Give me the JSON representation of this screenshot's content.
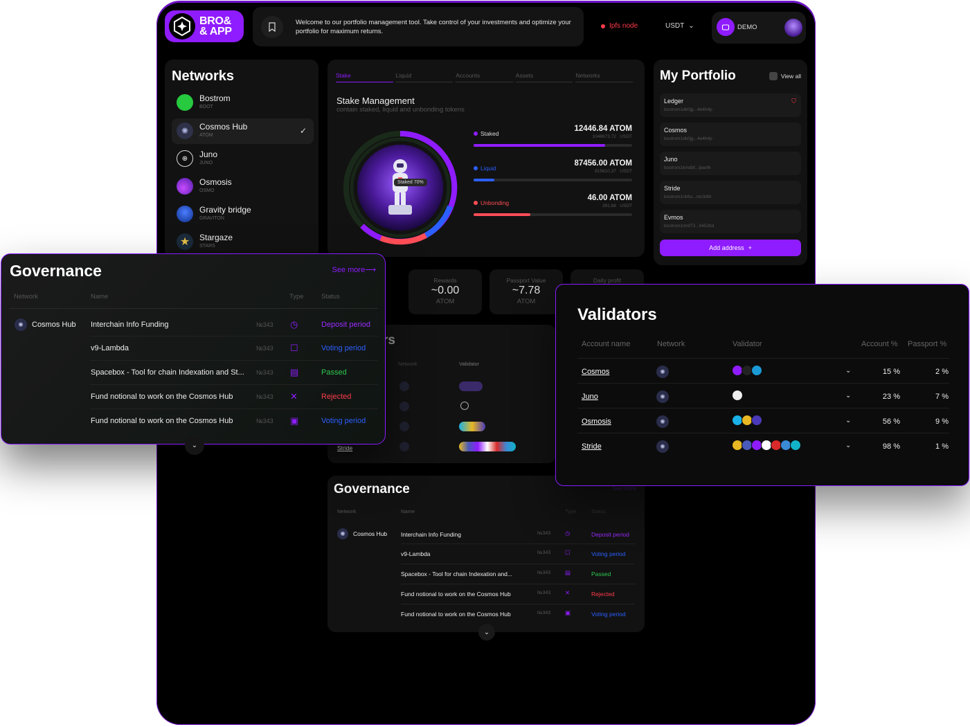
{
  "header": {
    "logo_line1": "BRO&",
    "logo_line2": "& APP",
    "banner": "Welcome to our portfolio management tool. Take control of your investments and optimize your portfolio for maximum returns.",
    "node_status": "Ipfs node",
    "currency": "USDT",
    "account": "DEMO"
  },
  "networks": {
    "title": "Networks",
    "items": [
      {
        "name": "Bostrom",
        "ticker": "BOOT",
        "color": "#27c93f"
      },
      {
        "name": "Cosmos Hub",
        "ticker": "ATOM",
        "color": "#2e3148"
      },
      {
        "name": "Juno",
        "ticker": "JUNO",
        "color": "#0f0f0f"
      },
      {
        "name": "Osmosis",
        "ticker": "OSMO",
        "color": "#7a2bd6"
      },
      {
        "name": "Gravity bridge",
        "ticker": "GRAVITON",
        "color": "#1a4fd6"
      },
      {
        "name": "Stargaze",
        "ticker": "STARS",
        "color": "#d8b437"
      }
    ]
  },
  "stake": {
    "tabs": [
      "Stake",
      "Liquid",
      "Accounts",
      "Assets",
      "Networks"
    ],
    "title": "Stake Management",
    "subtitle": "contain staked, liquid and unbonding tokens",
    "pill": "Staked 70%",
    "rows": [
      {
        "label": "Staked",
        "amount": "12446.84",
        "unit": "ATOM",
        "sub": "1048673,72",
        "sub_unit": "USDT",
        "color": "#8f1cff",
        "fill": 0.83
      },
      {
        "label": "Liquid",
        "amount": "87456.00",
        "unit": "ATOM",
        "sub": "815610,37",
        "sub_unit": "USDT",
        "color": "#2b5fff",
        "fill": 0.13
      },
      {
        "label": "Unbonding",
        "amount": "46.00",
        "unit": "ATOM",
        "sub": "391,68",
        "sub_unit": "USDT",
        "color": "#ff4d57",
        "fill": 0.36
      }
    ]
  },
  "portfolio": {
    "title": "My Portfolio",
    "view_all": "View all",
    "accounts": [
      {
        "name": "Ledger",
        "address": "bostrom1dk0jg...4e4h4p"
      },
      {
        "name": "Cosmos",
        "address": "bostrom1dk0jg...4e4h4p"
      },
      {
        "name": "Juno",
        "address": "bostrom1kmdbf...lpanfk"
      },
      {
        "name": "Stride",
        "address": "bostrom1nbfsr...mn3d9r"
      },
      {
        "name": "Evmos",
        "address": "bostrom1mnf73...6452bd"
      }
    ],
    "add_label": "Add address"
  },
  "stats": [
    {
      "title": "Rewards",
      "value": "~0.00",
      "unit": "ATOM"
    },
    {
      "title": "Passport Value",
      "value": "~7.78",
      "unit": "ATOM"
    },
    {
      "title": "Daily profit",
      "value": "",
      "unit": ""
    }
  ],
  "bg_validators": {
    "title_fragment": "rs",
    "network_header": "Network",
    "validator_header": "Validator",
    "last_row": "Stride"
  },
  "governance": {
    "title": "Governance",
    "see_more": "See more",
    "headers": {
      "network": "Network",
      "name": "Name",
      "type": "Type",
      "status": "Status"
    },
    "rows": [
      {
        "network": "Cosmos Hub",
        "name": "Interchain Info Funding",
        "short_name": "Interchain Info Funding",
        "number": "№343",
        "type_icon": "piggy-bank-icon",
        "status": "Deposit period",
        "status_class": "c-deposit"
      },
      {
        "network": "",
        "name": "v9-Lambda",
        "short_name": "v9-Lambda",
        "number": "№343",
        "type_icon": "ballot-box-icon",
        "status": "Voting period",
        "status_class": "c-voting"
      },
      {
        "network": "",
        "name": "Spacebox - Tool for chain Indexation and St...",
        "short_name": "Spacebox - Tool for chain Indexation and...",
        "number": "№343",
        "type_icon": "document-check-icon",
        "status": "Passed",
        "status_class": "c-passed"
      },
      {
        "network": "",
        "name": "Fund notional to work on the Cosmos Hub",
        "short_name": "Fund notional to work on the Cosmos Hub",
        "number": "№343",
        "type_icon": "tools-icon",
        "status": "Rejected",
        "status_class": "c-rejected"
      },
      {
        "network": "",
        "name": "Fund notional to work on the Cosmos Hub",
        "short_name": "Fund notional to work on the Cosmos Hub",
        "number": "№343",
        "type_icon": "calendar-icon",
        "status": "Voting period",
        "status_class": "c-voting"
      }
    ]
  },
  "validators": {
    "title": "Validators",
    "headers": {
      "account": "Account name",
      "network": "Network",
      "validator": "Validator",
      "account_pct": "Account %",
      "passport_pct": "Passport %"
    },
    "rows": [
      {
        "account": "Cosmos",
        "icons": [
          "#8f1cff",
          "#222",
          "#1b9ad6"
        ],
        "account_pct": "15 %",
        "passport_pct": "2 %"
      },
      {
        "account": "Juno",
        "icons": [
          "#eee"
        ],
        "account_pct": "23 %",
        "passport_pct": "7 %"
      },
      {
        "account": "Osmosis",
        "icons": [
          "#1ab1e8",
          "#e7b823",
          "#4a3ab8"
        ],
        "account_pct": "56 %",
        "passport_pct": "9 %"
      },
      {
        "account": "Stride",
        "icons": [
          "#e7b823",
          "#4a5ab8",
          "#8f1cff",
          "#ffffff",
          "#d82a2a",
          "#3a8ad6",
          "#12b3c8"
        ],
        "account_pct": "98 %",
        "passport_pct": "1 %"
      }
    ]
  }
}
